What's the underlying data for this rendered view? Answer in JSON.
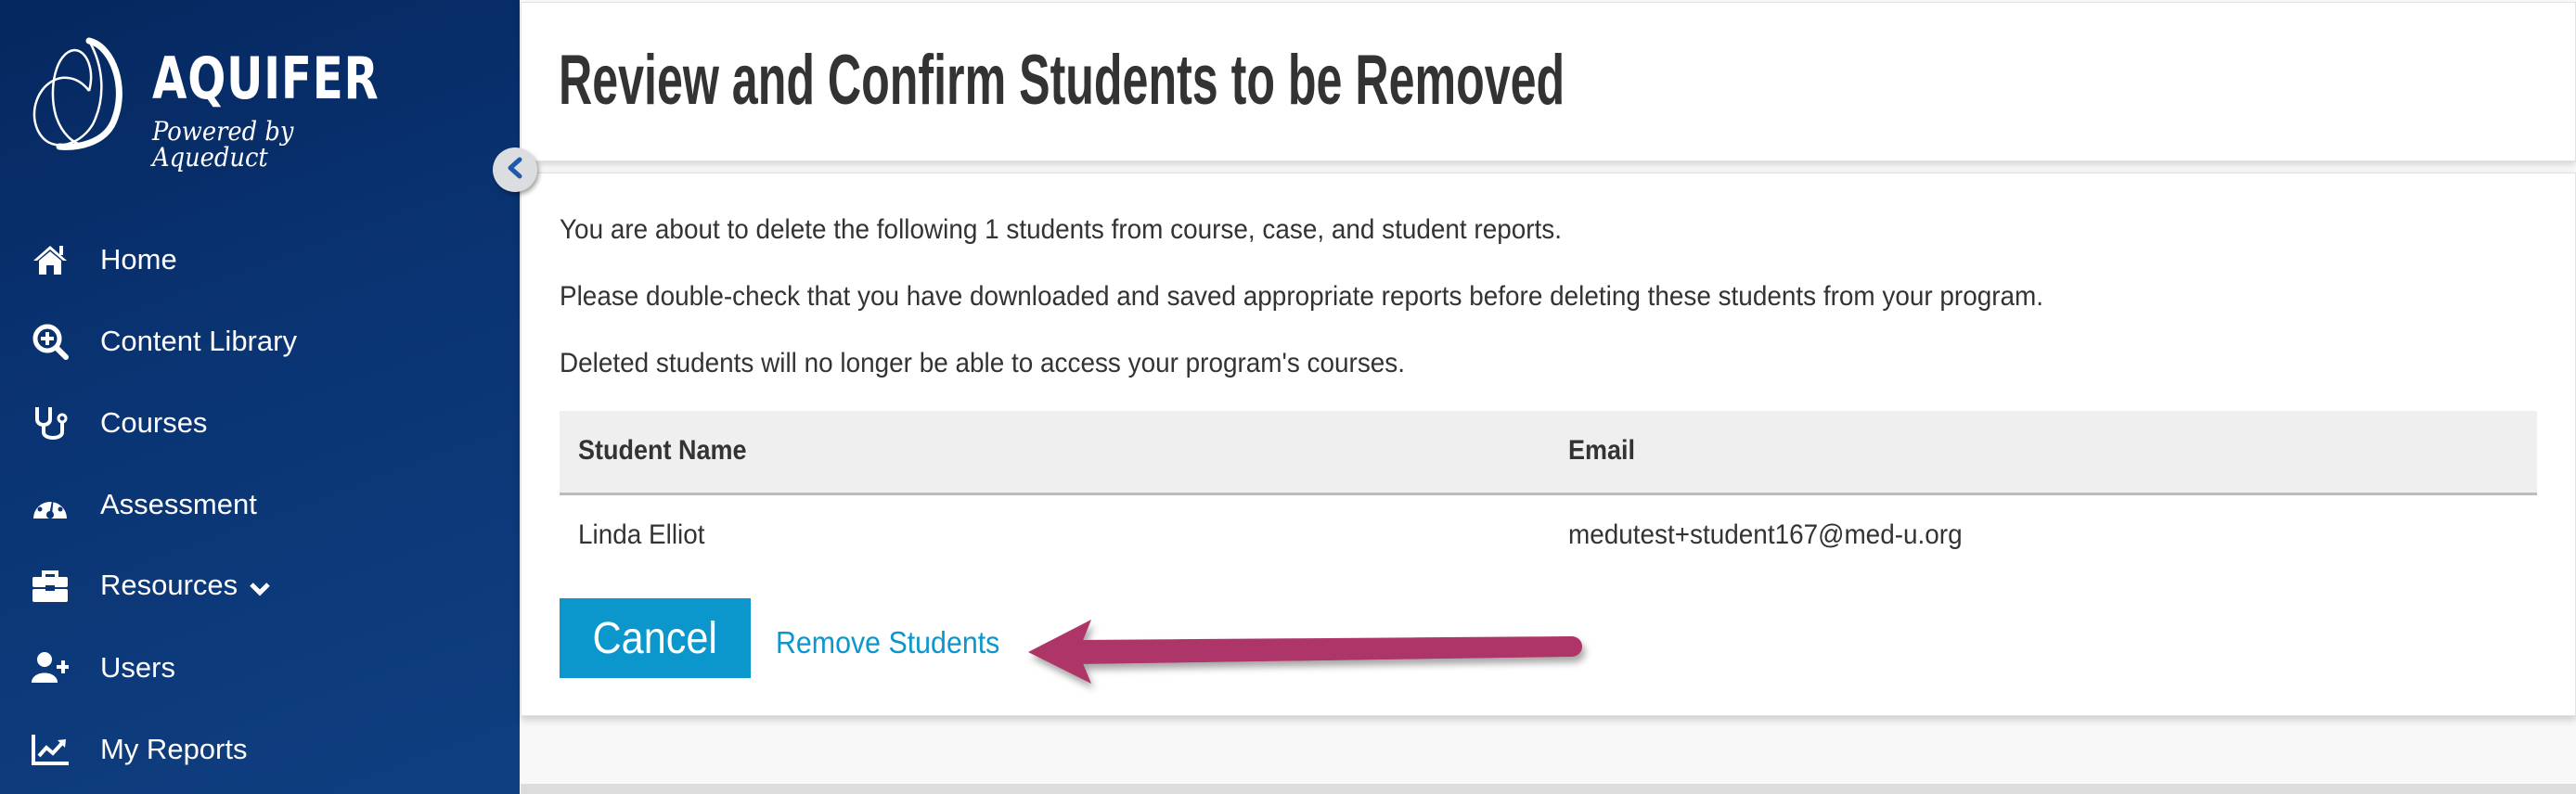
{
  "app": {
    "brand_name": "AQUIFER",
    "brand_tagline": "Powered by Aqueduct",
    "accent_color": "#0b97cc",
    "sidebar_color": "#0a3473",
    "annotation_color": "#ad3568"
  },
  "sidebar": {
    "collapse_icon": "chevron-left-icon",
    "items": [
      {
        "label": "Home",
        "icon": "home-icon"
      },
      {
        "label": "Content Library",
        "icon": "search-plus-icon"
      },
      {
        "label": "Courses",
        "icon": "stethoscope-icon"
      },
      {
        "label": "Assessment",
        "icon": "gauge-icon"
      },
      {
        "label": "Resources",
        "icon": "toolbox-icon",
        "has_dropdown": true
      },
      {
        "label": "Users",
        "icon": "user-plus-icon"
      },
      {
        "label": "My Reports",
        "icon": "chart-line-icon"
      }
    ]
  },
  "header": {
    "title": "Review and Confirm Students to be Removed"
  },
  "main": {
    "paragraphs": [
      "You are about to delete the following 1 students from course, case, and student reports.",
      "Please double-check that you have downloaded and saved appropriate reports before deleting these students from your program.",
      "Deleted students will no longer be able to access your program's courses."
    ],
    "table": {
      "columns": [
        "Student Name",
        "Email"
      ],
      "rows": [
        [
          "Linda Elliot",
          "medutest+student167@med-u.org"
        ]
      ]
    },
    "actions": {
      "cancel_label": "Cancel",
      "remove_label": "Remove Students"
    }
  }
}
